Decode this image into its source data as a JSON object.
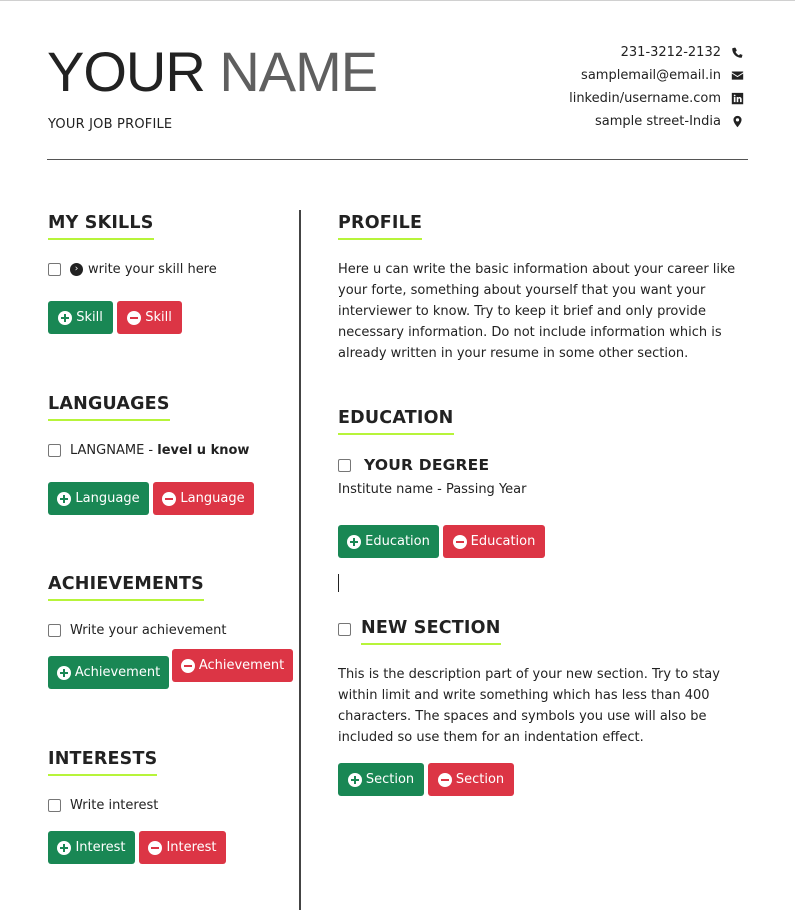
{
  "header": {
    "first_name": "YOUR",
    "last_name": "NAME",
    "job_profile": "YOUR JOB PROFILE"
  },
  "contacts": [
    {
      "text": "231-3212-2132",
      "icon": "phone-icon"
    },
    {
      "text": "samplemail@email.in",
      "icon": "envelope-icon"
    },
    {
      "text": "linkedin/username.com",
      "icon": "linkedin-icon"
    },
    {
      "text": "sample street-India",
      "icon": "map-marker-icon"
    }
  ],
  "colors": {
    "accent": "#b7f43a",
    "add_button": "#198754",
    "remove_button": "#dc3545"
  },
  "skills": {
    "title": "MY SKILLS",
    "item": "write your skill here",
    "add_label": "Skill",
    "remove_label": "Skill"
  },
  "languages": {
    "title": "LANGUAGES",
    "name": "LANGNAME",
    "separator": " - ",
    "level": "level u know",
    "add_label": "Language",
    "remove_label": "Language"
  },
  "achievements": {
    "title": "ACHIEVEMENTS",
    "item": "Write your achievement",
    "add_label": "Achievement",
    "remove_label": "Achievement"
  },
  "interests": {
    "title": "INTERESTS",
    "item": "Write interest",
    "add_label": "Interest",
    "remove_label": "Interest"
  },
  "profile": {
    "title": "PROFILE",
    "lines": [
      "Here u can write the basic information about your career like",
      "your forte, something about yourself that you want your",
      "interviewer to know. Try to keep it brief and only provide",
      "necessary information. Do not include information which is",
      "already written in your resume in some other section."
    ]
  },
  "education": {
    "title": "EDUCATION",
    "degree": "YOUR DEGREE",
    "institute": "Institute name - Passing Year",
    "add_label": "Education",
    "remove_label": "Education"
  },
  "new_section": {
    "title": "NEW SECTION",
    "lines": [
      "This is the description part of your new section. Try to stay",
      "within limit and write something which has less than 400",
      "characters. The spaces and symbols you use will also be",
      "included so use them for an indentation effect."
    ],
    "add_label": "Section",
    "remove_label": "Section"
  }
}
